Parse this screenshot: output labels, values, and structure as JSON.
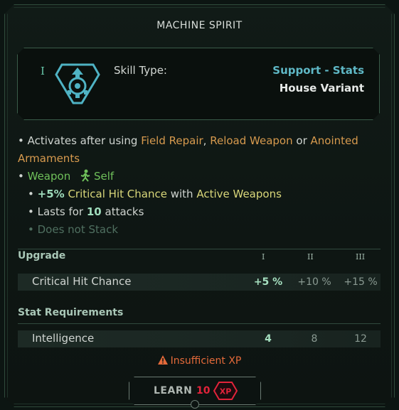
{
  "title": "MACHINE SPIRIT",
  "tier": "I",
  "skill_type_label": "Skill Type:",
  "skill_type_value": "Support - Stats",
  "variant": "House Variant",
  "icon": "support-stats-gear-icon",
  "description": {
    "activates_prefix": "Activates after using",
    "abilities": [
      "Field Repair",
      "Reload Weapon",
      "Anointed Armaments"
    ],
    "joiner_or": "or",
    "comma": ",",
    "target_type": "Weapon",
    "target_self": "Self",
    "effect_value": "+5%",
    "effect_stat": "Critical Hit Chance",
    "effect_with": "with",
    "effect_target": "Active Weapons",
    "duration_prefix": "Lasts for",
    "duration_value": "10",
    "duration_suffix": "attacks",
    "stacking": "Does not Stack"
  },
  "upgrade": {
    "header": "Upgrade",
    "levels": [
      "I",
      "II",
      "III"
    ],
    "row_label": "Critical Hit Chance",
    "values": [
      "+5 %",
      "+10 %",
      "+15 %"
    ]
  },
  "requirements": {
    "header": "Stat Requirements",
    "row_label": "Intelligence",
    "values": [
      "4",
      "8",
      "12"
    ]
  },
  "warning": "Insufficient XP",
  "learn": {
    "label": "LEARN",
    "cost": "10",
    "currency": "XP"
  },
  "colors": {
    "ability": "#d79a4e",
    "green": "#6fc05a",
    "skill_type": "#5fb8c6",
    "warning": "#e46a3a",
    "cost": "#e2233a"
  }
}
